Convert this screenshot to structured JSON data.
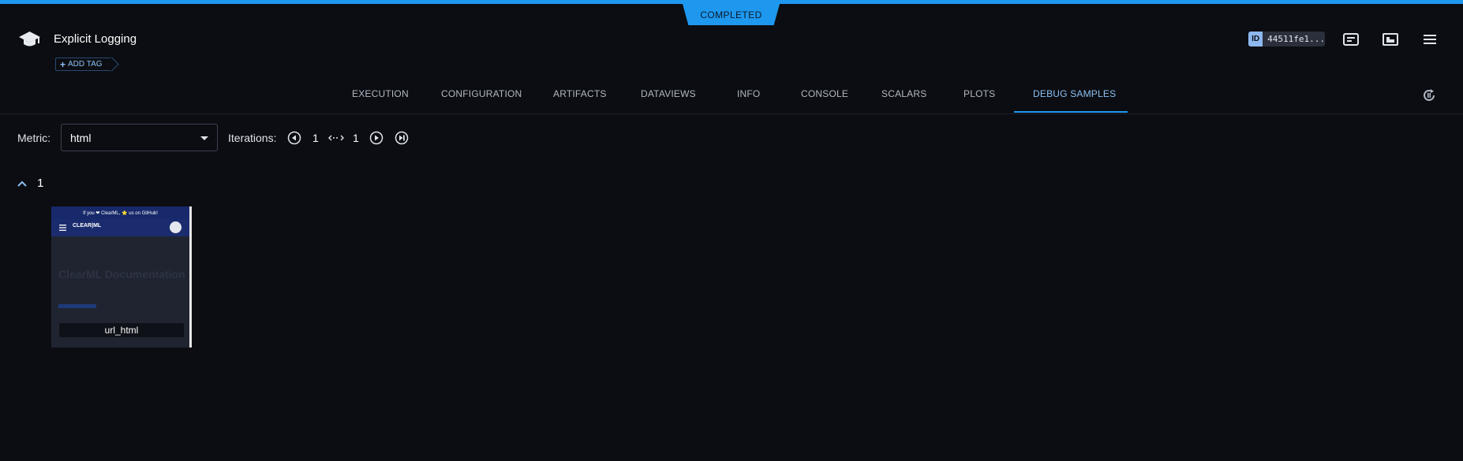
{
  "header": {
    "status": "COMPLETED",
    "title": "Explicit Logging",
    "add_tag_label": "ADD TAG",
    "id_label": "ID",
    "id_value": "44511fe1..."
  },
  "tabs": [
    {
      "label": "EXECUTION"
    },
    {
      "label": "CONFIGURATION"
    },
    {
      "label": "ARTIFACTS"
    },
    {
      "label": "DATAVIEWS"
    },
    {
      "label": "INFO"
    },
    {
      "label": "CONSOLE"
    },
    {
      "label": "SCALARS"
    },
    {
      "label": "PLOTS"
    },
    {
      "label": "DEBUG SAMPLES"
    }
  ],
  "active_tab": "DEBUG SAMPLES",
  "toolbar": {
    "metric_label": "Metric:",
    "metric_value": "html",
    "iterations_label": "Iterations:",
    "iteration_current": "1",
    "iteration_max": "1"
  },
  "group": {
    "label": "1",
    "samples": [
      {
        "label": "url_html",
        "thumb_banner": "If you ❤ ClearML, ⭐ us on GitHub!",
        "thumb_logo": "CLEAR|ML",
        "thumb_heading": "ClearML Documentation"
      }
    ]
  },
  "colors": {
    "accent": "#1e98ef",
    "background": "#0b0d12",
    "active_tab": "#8cc0f3"
  }
}
